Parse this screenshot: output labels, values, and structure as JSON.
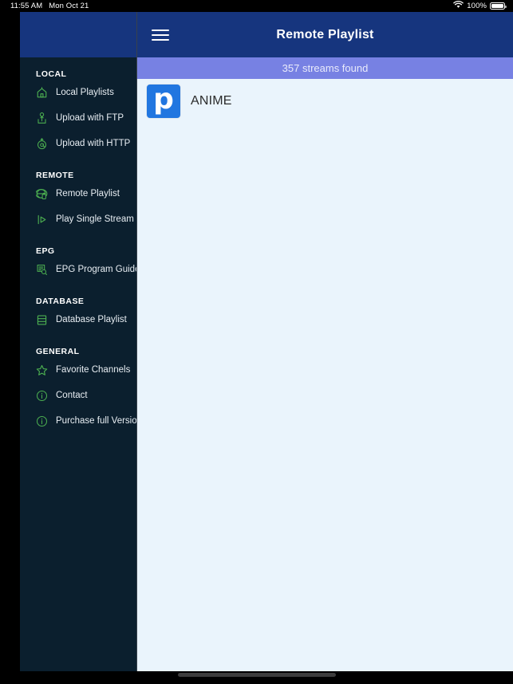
{
  "status_bar": {
    "time": "11:55 AM",
    "date": "Mon Oct 21",
    "wifi_icon": "wifi-icon",
    "battery_percent": "100%",
    "battery_icon": "battery-icon"
  },
  "sidebar": {
    "sections": [
      {
        "title": "LOCAL",
        "items": [
          {
            "label": "Local Playlists",
            "icon": "home-icon"
          },
          {
            "label": "Upload with FTP",
            "icon": "ftp-upload-icon"
          },
          {
            "label": "Upload with HTTP",
            "icon": "http-upload-icon"
          }
        ]
      },
      {
        "title": "REMOTE",
        "items": [
          {
            "label": "Remote Playlist",
            "icon": "globe-icon"
          },
          {
            "label": "Play Single Stream",
            "icon": "play-stream-icon"
          }
        ]
      },
      {
        "title": "EPG",
        "items": [
          {
            "label": "EPG Program Guide",
            "icon": "document-search-icon"
          }
        ]
      },
      {
        "title": "DATABASE",
        "items": [
          {
            "label": "Database Playlist",
            "icon": "database-list-icon"
          }
        ]
      },
      {
        "title": "GENERAL",
        "items": [
          {
            "label": "Favorite Channels",
            "icon": "star-icon"
          },
          {
            "label": "Contact",
            "icon": "info-circle-icon"
          },
          {
            "label": "Purchase full Version",
            "icon": "info-circle-icon"
          }
        ]
      }
    ]
  },
  "navbar": {
    "menu_icon": "hamburger-menu-icon",
    "title": "Remote Playlist"
  },
  "streams_bar": {
    "text": "357 streams found"
  },
  "stream_list": {
    "rows": [
      {
        "logo_letter": "p",
        "name": "ANIME"
      }
    ]
  },
  "colors": {
    "navbar_blue": "#16357e",
    "streams_bar_purple": "#7781e3",
    "sidebar_navy": "#0b1f2e",
    "content_background": "#eaf4fc",
    "icon_green": "#4caf50",
    "logo_blue": "#2176e0"
  }
}
